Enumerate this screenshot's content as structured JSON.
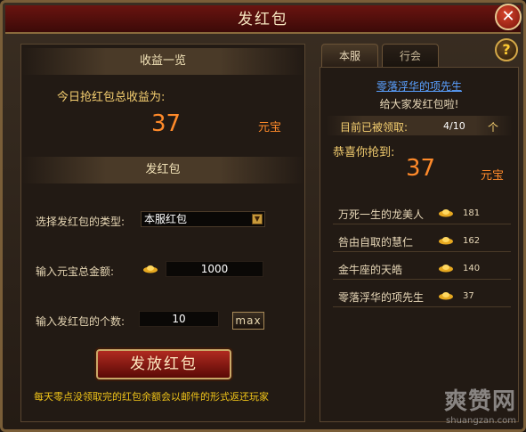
{
  "window": {
    "title": "发红包",
    "close_icon": "✕",
    "help_icon": "?"
  },
  "left": {
    "income_header": "收益一览",
    "today_income_label": "今日抢红包总收益为:",
    "today_income_value": "37",
    "currency_unit": "元宝",
    "send_header": "发红包",
    "type_label": "选择发红包的类型:",
    "type_selected": "本服红包",
    "total_label": "输入元宝总金额:",
    "total_value": "1000",
    "count_label": "输入发红包的个数:",
    "count_value": "10",
    "max_label": "max",
    "send_button": "发放红包",
    "notice": "每天零点没领取完的红包余额会以邮件的形式返还玩家"
  },
  "right": {
    "tabs": [
      {
        "label": "本服",
        "active": true
      },
      {
        "label": "行会",
        "active": false
      }
    ],
    "sender_name": "零落浮华的项先生",
    "sender_message": "给大家发红包啦!",
    "claimed_label": "目前已被领取:",
    "claimed_count": "4/10",
    "claimed_unit": "个",
    "congrats_label": "恭喜你抢到:",
    "grabbed_value": "37",
    "currency_unit": "元宝",
    "winners": [
      {
        "name": "万死一生的龙美人",
        "amount": "181"
      },
      {
        "name": "咎由自取的慧仁",
        "amount": "162"
      },
      {
        "name": "金牛座的天皓",
        "amount": "140"
      },
      {
        "name": "零落浮华的项先生",
        "amount": "37"
      }
    ]
  },
  "watermark": {
    "brand": "爽赞网",
    "url": "shuangzan.com"
  },
  "colors": {
    "accent_orange": "#ff8a2a",
    "gold": "#f5cf70",
    "link_blue": "#5aa0ff",
    "notice_yellow": "#f0c419"
  }
}
